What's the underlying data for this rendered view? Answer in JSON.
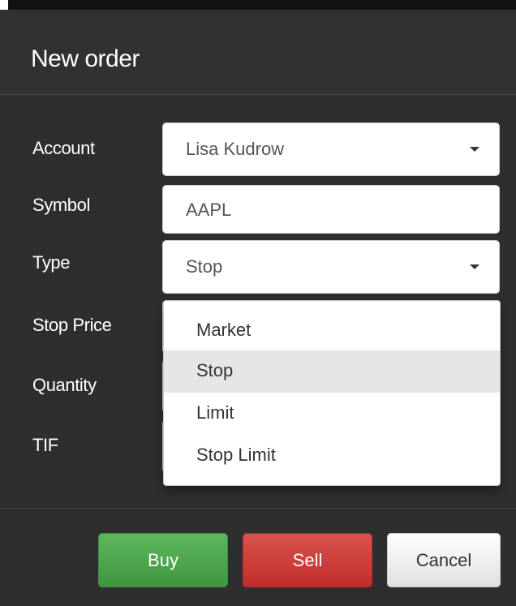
{
  "dialog": {
    "title": "New order"
  },
  "form": {
    "account_label": "Account",
    "account_value": "Lisa Kudrow",
    "symbol_label": "Symbol",
    "symbol_value": "AAPL",
    "type_label": "Type",
    "type_value": "Stop",
    "stop_price_label": "Stop Price",
    "quantity_label": "Quantity",
    "tif_label": "TIF"
  },
  "type_dropdown": {
    "options": [
      "Market",
      "Stop",
      "Limit",
      "Stop Limit"
    ],
    "highlighted": "Stop"
  },
  "footer": {
    "buy_label": "Buy",
    "sell_label": "Sell",
    "cancel_label": "Cancel"
  },
  "colors": {
    "buy": "#5cb85c",
    "sell": "#d9534f",
    "background": "#2e2e2e"
  }
}
